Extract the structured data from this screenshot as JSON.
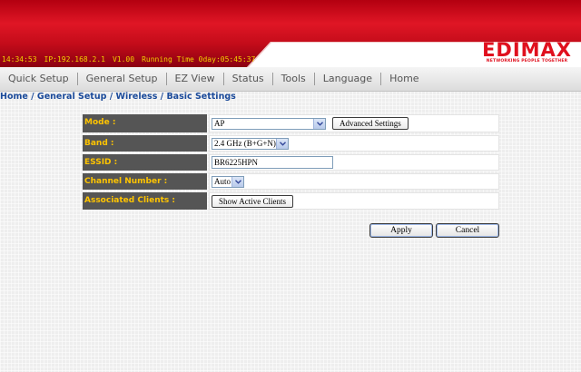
{
  "header": {
    "time": "14:34:53",
    "ip": "IP:192.168.2.1",
    "version": "V1.00",
    "running_time": "Running Time 0day:05:45:37",
    "logo": "EDIMAX",
    "logo_tagline": "NETWORKING PEOPLE TOGETHER",
    "colors": {
      "brand_red": "#e0101e",
      "status_text": "#f3d200"
    }
  },
  "nav": {
    "items": [
      {
        "label": "Quick Setup"
      },
      {
        "label": "General Setup"
      },
      {
        "label": "EZ View"
      },
      {
        "label": "Status"
      },
      {
        "label": "Tools"
      },
      {
        "label": "Language"
      },
      {
        "label": "Home"
      }
    ]
  },
  "breadcrumb": "Home / General Setup / Wireless / Basic Settings",
  "form": {
    "mode": {
      "label": "Mode :",
      "value": "AP",
      "advanced_button": "Advanced Settings"
    },
    "band": {
      "label": "Band :",
      "value": "2.4 GHz (B+G+N)"
    },
    "essid": {
      "label": "ESSID :",
      "value": "BR6225HPN"
    },
    "channel": {
      "label": "Channel Number :",
      "value": "Auto"
    },
    "clients": {
      "label": "Associated Clients :",
      "button": "Show Active Clients"
    }
  },
  "actions": {
    "apply": "Apply",
    "cancel": "Cancel"
  }
}
